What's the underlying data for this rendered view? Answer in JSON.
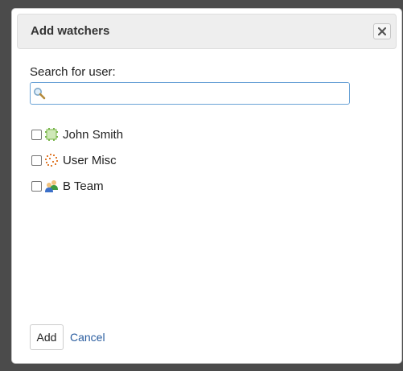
{
  "dialog": {
    "title": "Add watchers",
    "close_icon": "close-x-icon"
  },
  "search": {
    "label": "Search for user:",
    "value": "",
    "placeholder": "",
    "icon": "magnifier-icon"
  },
  "users": [
    {
      "name": "John Smith",
      "icon": "user-avatar-icon",
      "checked": false
    },
    {
      "name": "User Misc",
      "icon": "user-avatar-icon",
      "checked": false
    },
    {
      "name": "B Team",
      "icon": "group-icon",
      "checked": false
    }
  ],
  "actions": {
    "add_label": "Add",
    "cancel_label": "Cancel"
  },
  "colors": {
    "link": "#2a5d9f",
    "search_border": "#6aa2d6",
    "titlebar_bg": "#eeeeee"
  }
}
